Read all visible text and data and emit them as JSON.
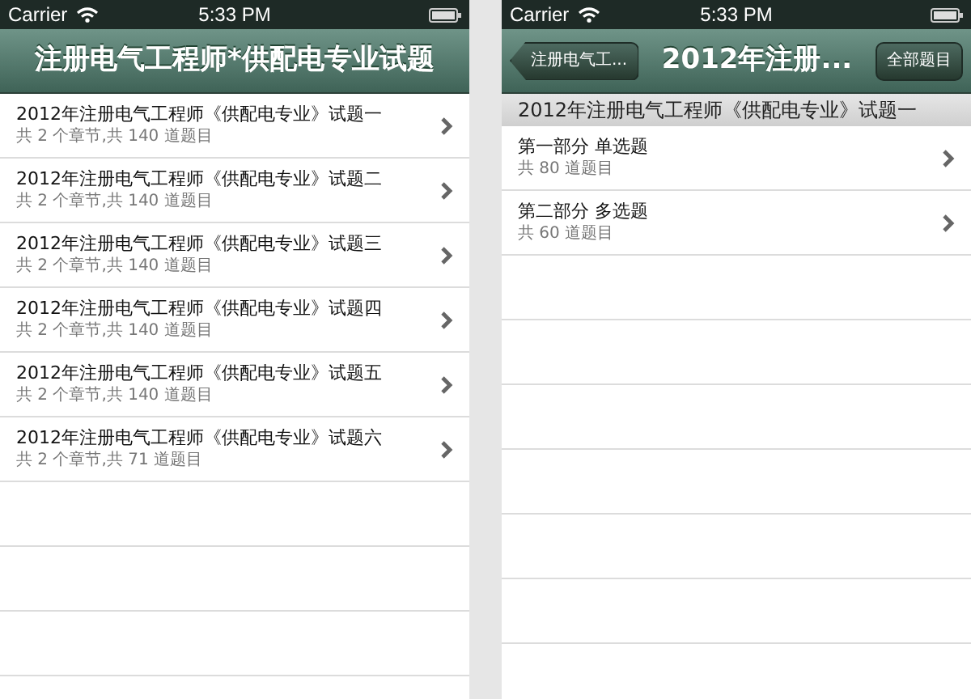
{
  "screens": [
    {
      "status_bar": {
        "carrier": "Carrier",
        "time": "5:33 PM"
      },
      "nav_bar": {
        "title": "注册电气工程师*供配电专业试题"
      },
      "rows": [
        {
          "title": "2012年注册电气工程师《供配电专业》试题一",
          "subtitle": "共 2 个章节,共 140 道题目"
        },
        {
          "title": "2012年注册电气工程师《供配电专业》试题二",
          "subtitle": "共 2 个章节,共 140 道题目"
        },
        {
          "title": "2012年注册电气工程师《供配电专业》试题三",
          "subtitle": "共 2 个章节,共 140 道题目"
        },
        {
          "title": "2012年注册电气工程师《供配电专业》试题四",
          "subtitle": "共 2 个章节,共 140 道题目"
        },
        {
          "title": "2012年注册电气工程师《供配电专业》试题五",
          "subtitle": "共 2 个章节,共 140 道题目"
        },
        {
          "title": "2012年注册电气工程师《供配电专业》试题六",
          "subtitle": "共 2 个章节,共 71 道题目"
        }
      ]
    },
    {
      "status_bar": {
        "carrier": "Carrier",
        "time": "5:33 PM"
      },
      "nav_bar": {
        "back_button": "注册电气工...",
        "title": "2012年注册...",
        "right_button": "全部题目"
      },
      "section_header": "2012年注册电气工程师《供配电专业》试题一",
      "rows": [
        {
          "title": "第一部分  单选题",
          "subtitle": "共 80 道题目"
        },
        {
          "title": "第二部分  多选题",
          "subtitle": "共 60 道题目"
        }
      ]
    }
  ]
}
